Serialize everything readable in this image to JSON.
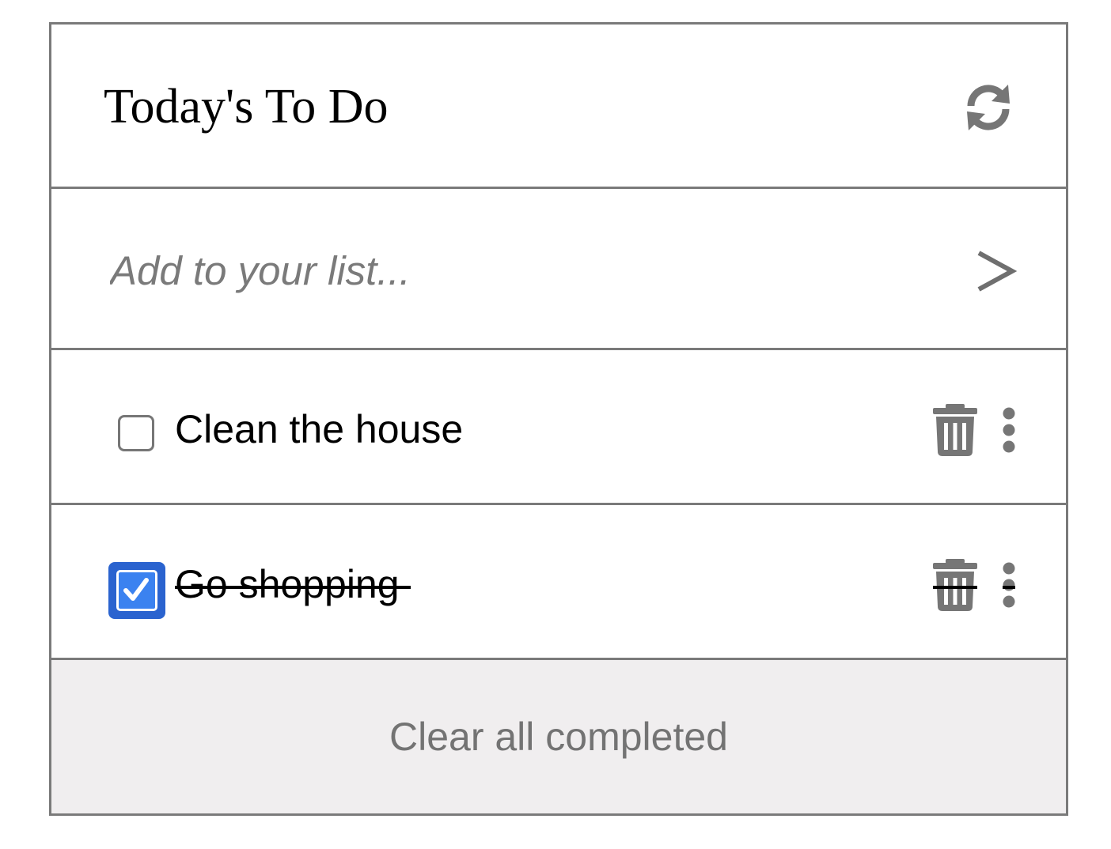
{
  "header": {
    "title": "Today's To Do",
    "refresh_icon": "refresh-icon"
  },
  "add": {
    "placeholder": "Add to your list...",
    "value": "",
    "submit_label": ">"
  },
  "items": [
    {
      "label": "Clean the house",
      "completed": false
    },
    {
      "label": "Go shopping",
      "completed": true
    }
  ],
  "footer": {
    "clear_label": "Clear all completed"
  },
  "colors": {
    "border": "#7a7a7a",
    "icon": "#767676",
    "checkbox_checked": "#2a63cf",
    "footer_bg": "#f0eeef",
    "placeholder": "#7a7a7a"
  }
}
